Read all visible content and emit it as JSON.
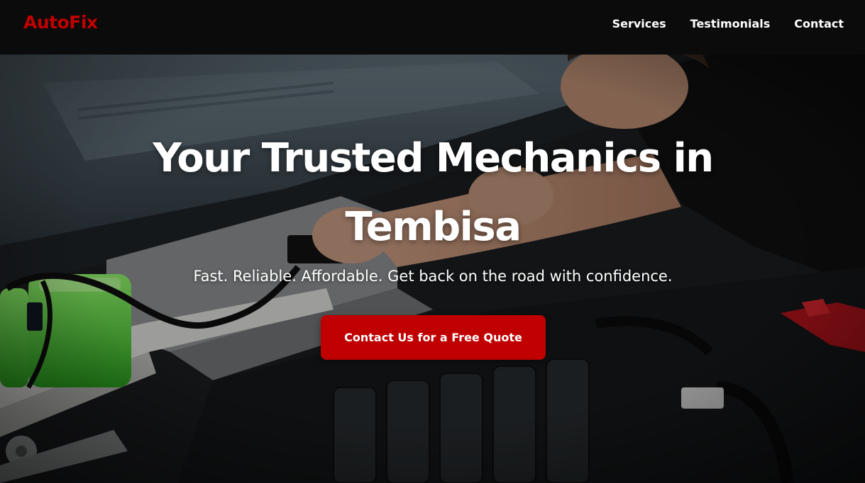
{
  "brand": {
    "name": "AutoFix",
    "color": "#c00000"
  },
  "nav": {
    "items": [
      {
        "label": "Services"
      },
      {
        "label": "Testimonials"
      },
      {
        "label": "Contact"
      }
    ]
  },
  "hero": {
    "title": "Your Trusted Mechanics in Tembisa",
    "subtitle": "Fast. Reliable. Affordable. Get back on the road with confidence.",
    "cta_label": "Contact Us for a Free Quote",
    "background_image": "mechanic-working-on-car-engine"
  },
  "colors": {
    "header_bg": "#0b0b0b",
    "accent": "#c00000",
    "text": "#ffffff"
  }
}
